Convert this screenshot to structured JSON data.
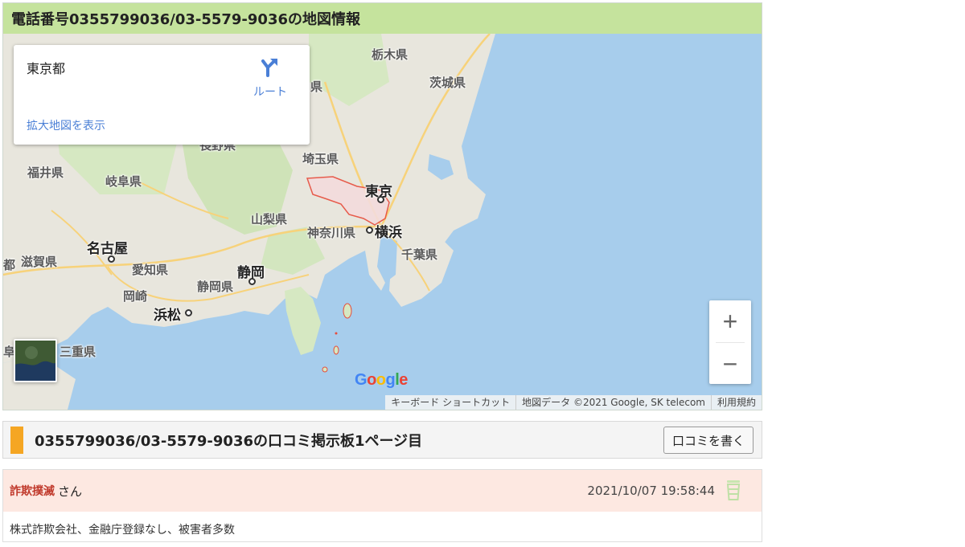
{
  "map_section": {
    "title": "電話番号0355799036/03-5579-9036の地図情報",
    "info_card": {
      "place": "東京都",
      "route_label": "ルート",
      "enlarge_link": "拡大地図を表示"
    },
    "labels": {
      "tochigi": "栃木県",
      "ibaraki": "茨城県",
      "gunma_partial": "県",
      "nagano_partial": "長野県",
      "fukui": "福井県",
      "gifu": "岐阜県",
      "saitama": "埼玉県",
      "tokyo": "東京",
      "yamanashi": "山梨県",
      "kanagawa": "神奈川県",
      "yokohama": "横浜",
      "chiba": "千葉県",
      "nagoya": "名古屋",
      "kyoto_partial": "都",
      "shiga": "滋賀県",
      "aichi": "愛知県",
      "shizuoka_city": "静岡",
      "shizuoka": "静岡県",
      "okazaki": "岡崎",
      "hamamatsu": "浜松",
      "mie": "三重県",
      "shin_partial": "阜"
    },
    "zoom": {
      "in": "+",
      "out": "−"
    },
    "google_logo": [
      "G",
      "o",
      "o",
      "g",
      "l",
      "e"
    ],
    "google_colors": [
      "#4285f4",
      "#ea4335",
      "#fbbc05",
      "#4285f4",
      "#34a853",
      "#ea4335"
    ],
    "attribution": {
      "shortcuts": "キーボード ショートカット",
      "data": "地図データ ©2021 Google, SK telecom",
      "terms": "利用規約"
    }
  },
  "board": {
    "title": "0355799036/03-5579-9036の口コミ掲示板1ページ目",
    "write_button": "口コミを書く",
    "accent_color": "#f5a623"
  },
  "comments": [
    {
      "name": "詐欺撲滅",
      "honorific": "さん",
      "date": "2021/10/07 19:58:44",
      "body": "株式詐欺会社、金融庁登録なし、被害者多数"
    }
  ]
}
